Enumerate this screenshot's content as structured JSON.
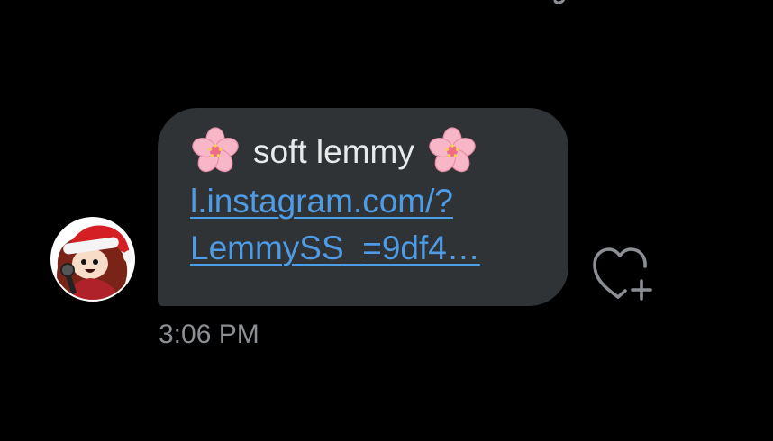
{
  "message": {
    "title_text": "soft lemmy",
    "title_emoji": "cherry-blossom-icon",
    "link_lines": [
      "l.instagram.com/?",
      "LemmySS_=9df4…"
    ],
    "timestamp": "3:06 PM"
  },
  "colors": {
    "background": "#000000",
    "bubble": "#2f3336",
    "text": "#e7e9ea",
    "link": "#4e9be6",
    "timestamp": "#8b8f93",
    "reaction_icon": "#8b8f93"
  },
  "icons": {
    "avatar": "avatar-icon",
    "reaction": "heart-plus-icon"
  }
}
